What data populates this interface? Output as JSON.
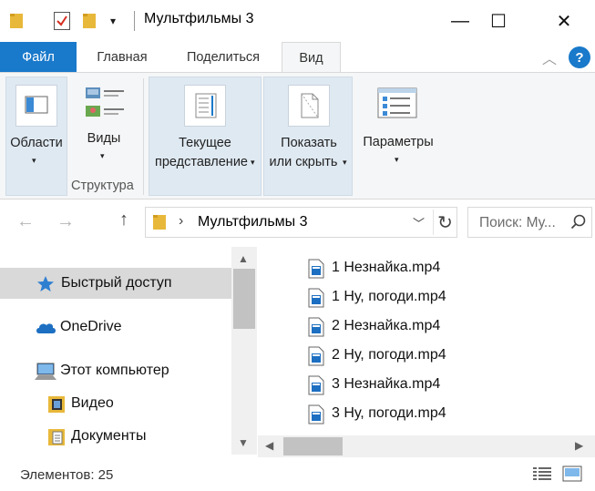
{
  "window": {
    "title": "Мультфильмы 3",
    "minimize_glyph": "—",
    "maximize_glyph": "☐",
    "close_glyph": "✕"
  },
  "quick_access_toolbar": {
    "caret_glyph": "▾"
  },
  "ribbon_tabs": [
    {
      "label": "Файл"
    },
    {
      "label": "Главная"
    },
    {
      "label": "Поделиться"
    },
    {
      "label": "Вид"
    }
  ],
  "ribbon_help_glyph": "?",
  "ribbon_collapse_glyph": "︿",
  "ribbon": {
    "panes_label": "Области",
    "layout_label": "Виды",
    "layout_group": "Структура",
    "current_view_line1": "Текущее",
    "current_view_line2": "представление",
    "show_hide_line1": "Показать",
    "show_hide_line2": "или скрыть",
    "options_label": "Параметры",
    "caret": "▾"
  },
  "address_bar": {
    "path": "Мультфильмы 3",
    "chevron": "›",
    "dropdown_glyph": "﹀",
    "refresh_glyph": "↻"
  },
  "nav_buttons": {
    "back": "←",
    "forward": "→",
    "up": "↑"
  },
  "search": {
    "placeholder": "Поиск: Му..."
  },
  "nav_pane": {
    "items": [
      {
        "label": "Быстрый доступ"
      },
      {
        "label": "OneDrive"
      },
      {
        "label": "Этот компьютер"
      },
      {
        "label": "Видео"
      },
      {
        "label": "Документы"
      }
    ]
  },
  "files": [
    {
      "name": "1 Незнайка.mp4"
    },
    {
      "name": "1 Ну, погоди.mp4"
    },
    {
      "name": "2 Незнайка.mp4"
    },
    {
      "name": "2 Ну, погоди.mp4"
    },
    {
      "name": "3 Незнайка.mp4"
    },
    {
      "name": "3 Ну, погоди.mp4"
    }
  ],
  "scroll_glyphs": {
    "up": "▲",
    "down": "▼",
    "left": "◀",
    "right": "▶"
  },
  "status": {
    "items_count": "Элементов: 25"
  },
  "colors": {
    "accent": "#1979ca",
    "folder": "#e8b83a",
    "ribbon_bg": "#f5f6f7",
    "selected_bg": "#d9d9d9"
  }
}
